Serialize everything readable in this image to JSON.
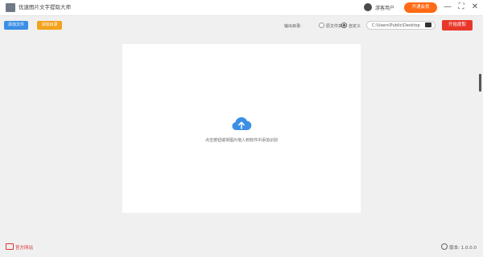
{
  "app": {
    "title": "优速图片文字提取大师",
    "user_name": "游客用户",
    "vip_label": "开通会员"
  },
  "window_controls": {
    "minimize": "—",
    "maximize": "⛶",
    "close": "✕"
  },
  "toolbar": {
    "add_file_label": "添加文件",
    "add_folder_label": "添加目录",
    "output_dir_label": "输出目录:",
    "option_original": "原文件夹",
    "option_custom": "自定义",
    "selected_option": "custom",
    "output_path": "C:\\Users\\Public\\Desktop",
    "start_label": "开始提取"
  },
  "drop_area": {
    "hint": "点击按钮或将图片拖入到软件中添加识别"
  },
  "footer": {
    "left_label": "官方网站",
    "version": "版本: 1.0.0.0"
  },
  "colors": {
    "add_file": "#3b8fe4",
    "add_folder": "#f2a21b",
    "start": "#e8372a",
    "vip": "#ff6a14",
    "upload_icon": "#3b8fe4"
  }
}
